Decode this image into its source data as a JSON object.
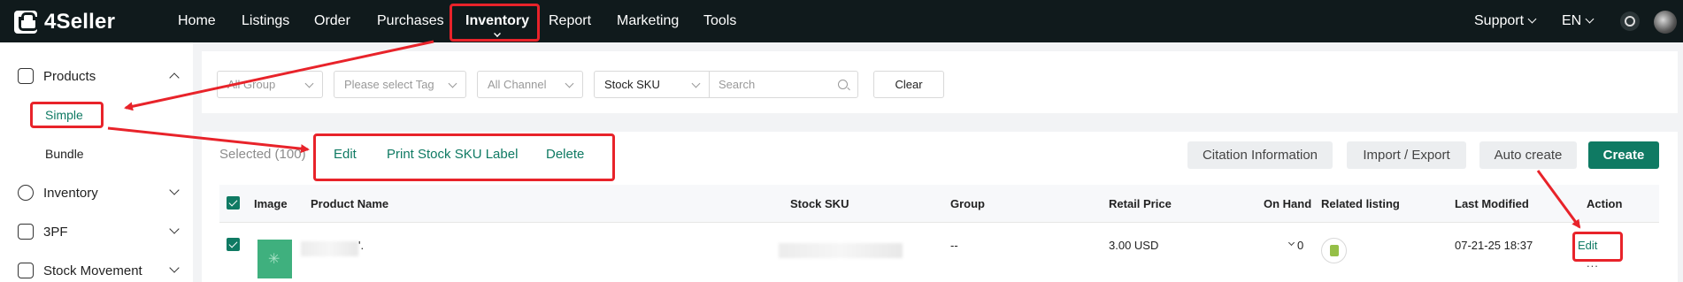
{
  "app": {
    "brand": "4Seller"
  },
  "topnav": {
    "items": [
      "Home",
      "Listings",
      "Order",
      "Purchases",
      "Inventory",
      "Report",
      "Marketing",
      "Tools"
    ],
    "active": "Inventory",
    "support_label": "Support",
    "language_label": "EN"
  },
  "sidebar": {
    "groups": [
      {
        "label": "Products",
        "icon": "box-icon",
        "expanded": true,
        "children": [
          "Simple",
          "Bundle"
        ],
        "active_child": "Simple"
      },
      {
        "label": "Inventory",
        "icon": "inventory-icon",
        "expanded": false
      },
      {
        "label": "3PF",
        "icon": "warehouse-icon",
        "expanded": false
      },
      {
        "label": "Stock Movement",
        "icon": "stock-movement-icon",
        "expanded": false
      }
    ]
  },
  "filters": {
    "group_placeholder": "All Group",
    "tag_placeholder": "Please select Tag",
    "channel_placeholder": "All Channel",
    "search_field": "Stock SKU",
    "search_placeholder": "Search",
    "clear_label": "Clear"
  },
  "toolbar": {
    "selected_text": "Selected (100)",
    "bulk_actions": [
      "Edit",
      "Print Stock SKU Label",
      "Delete"
    ],
    "citation_label": "Citation Information",
    "import_export_label": "Import / Export",
    "auto_create_label": "Auto create",
    "create_label": "Create"
  },
  "table": {
    "columns": [
      "Image",
      "Product Name",
      "Stock SKU",
      "Group",
      "Retail Price",
      "On Hand",
      "Related listing",
      "Last Modified",
      "Action"
    ],
    "rows": [
      {
        "checked": true,
        "product_name_suffix": "'.",
        "group": "--",
        "retail_price": "3.00 USD",
        "on_hand": "0",
        "related_listing_icon": "shopify-icon",
        "last_modified": "07-21-25 18:37",
        "action": "Edit",
        "more": "..."
      }
    ]
  },
  "colors": {
    "brand_green": "#0f7a63",
    "topbar_bg": "#101a1c",
    "annotation_red": "#e8232a"
  }
}
